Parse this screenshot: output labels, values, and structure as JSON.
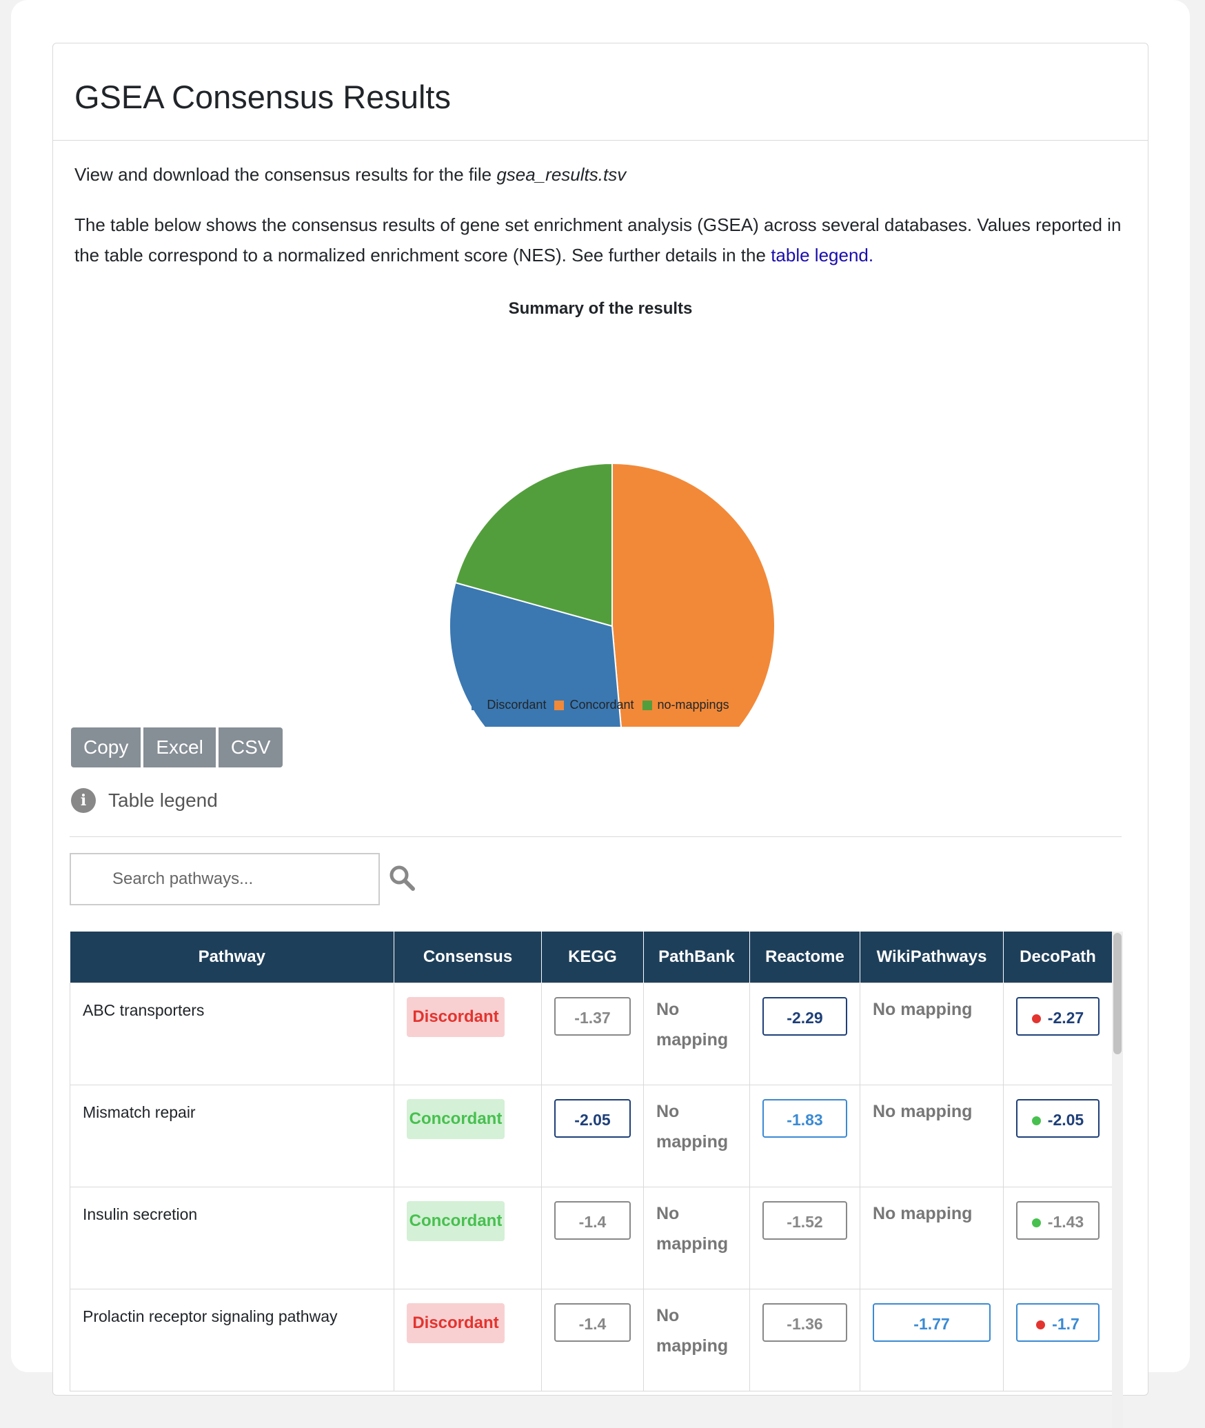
{
  "title": "GSEA Consensus Results",
  "intro": {
    "prefix": "View and download the consensus results for the file ",
    "filename": "gsea_results.tsv"
  },
  "description": {
    "text": "The table below shows the consensus results of gene set enrichment analysis (GSEA) across several databases. Values reported in the table correspond to a normalized enrichment score (NES). See further details in the ",
    "link": "table legend."
  },
  "chart_data": {
    "type": "pie",
    "title": "Summary of the results",
    "slices": [
      {
        "name": "Concordant",
        "value": 48.6,
        "color": "#f28938"
      },
      {
        "name": "Discordant",
        "value": 30.7,
        "color": "#3b78b1"
      },
      {
        "name": "no-mappings",
        "value": 20.7,
        "color": "#539e3c"
      }
    ],
    "legend_order": [
      "Discordant",
      "Concordant",
      "no-mappings"
    ],
    "legend_placement": "bottom"
  },
  "buttons": {
    "copy": "Copy",
    "excel": "Excel",
    "csv": "CSV"
  },
  "legend_toggle": {
    "icon": "i",
    "label": "Table legend"
  },
  "search": {
    "placeholder": "Search pathways..."
  },
  "table": {
    "headers": [
      "Pathway",
      "Consensus",
      "KEGG",
      "PathBank",
      "Reactome",
      "WikiPathways",
      "DecoPath"
    ],
    "rows": [
      {
        "pathway": "ABC transporters",
        "consensus": "Discordant",
        "kegg": "-1.37",
        "pathbank": "No mapping",
        "reactome": "-2.29",
        "wikipathways": "No mapping",
        "decopath": "-2.27"
      },
      {
        "pathway": "Mismatch repair",
        "consensus": "Concordant",
        "kegg": "-2.05",
        "pathbank": "No mapping",
        "reactome": "-1.83",
        "wikipathways": "No mapping",
        "decopath": "-2.05"
      },
      {
        "pathway": "Insulin secretion",
        "consensus": "Concordant",
        "kegg": "-1.4",
        "pathbank": "No mapping",
        "reactome": "-1.52",
        "wikipathways": "No mapping",
        "decopath": "-1.43"
      },
      {
        "pathway": "Prolactin receptor signaling pathway",
        "consensus": "Discordant",
        "kegg": "-1.4",
        "pathbank": "No mapping",
        "reactome": "-1.36",
        "wikipathways": "-1.77",
        "decopath": "-1.7"
      }
    ]
  }
}
